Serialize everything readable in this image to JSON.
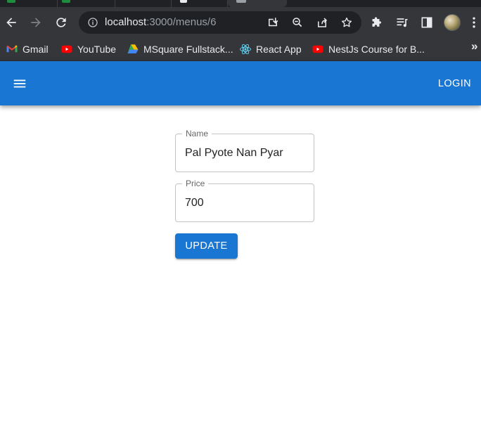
{
  "browser": {
    "url_host": "localhost",
    "url_path": ":3000/menus/6",
    "bookmarks": [
      {
        "label": "Gmail",
        "icon": "gmail-icon"
      },
      {
        "label": "YouTube",
        "icon": "youtube-icon"
      },
      {
        "label": "MSquare Fullstack...",
        "icon": "google-drive-icon"
      },
      {
        "label": "React App",
        "icon": "react-icon"
      },
      {
        "label": "NestJs Course for B...",
        "icon": "youtube-icon"
      }
    ],
    "bookmarks_more": "»"
  },
  "appbar": {
    "login_label": "LOGIN",
    "color": "#1976d2"
  },
  "form": {
    "name_label": "Name",
    "name_value": "Pal Pyote Nan Pyar",
    "price_label": "Price",
    "price_value": "700",
    "update_label": "UPDATE"
  }
}
